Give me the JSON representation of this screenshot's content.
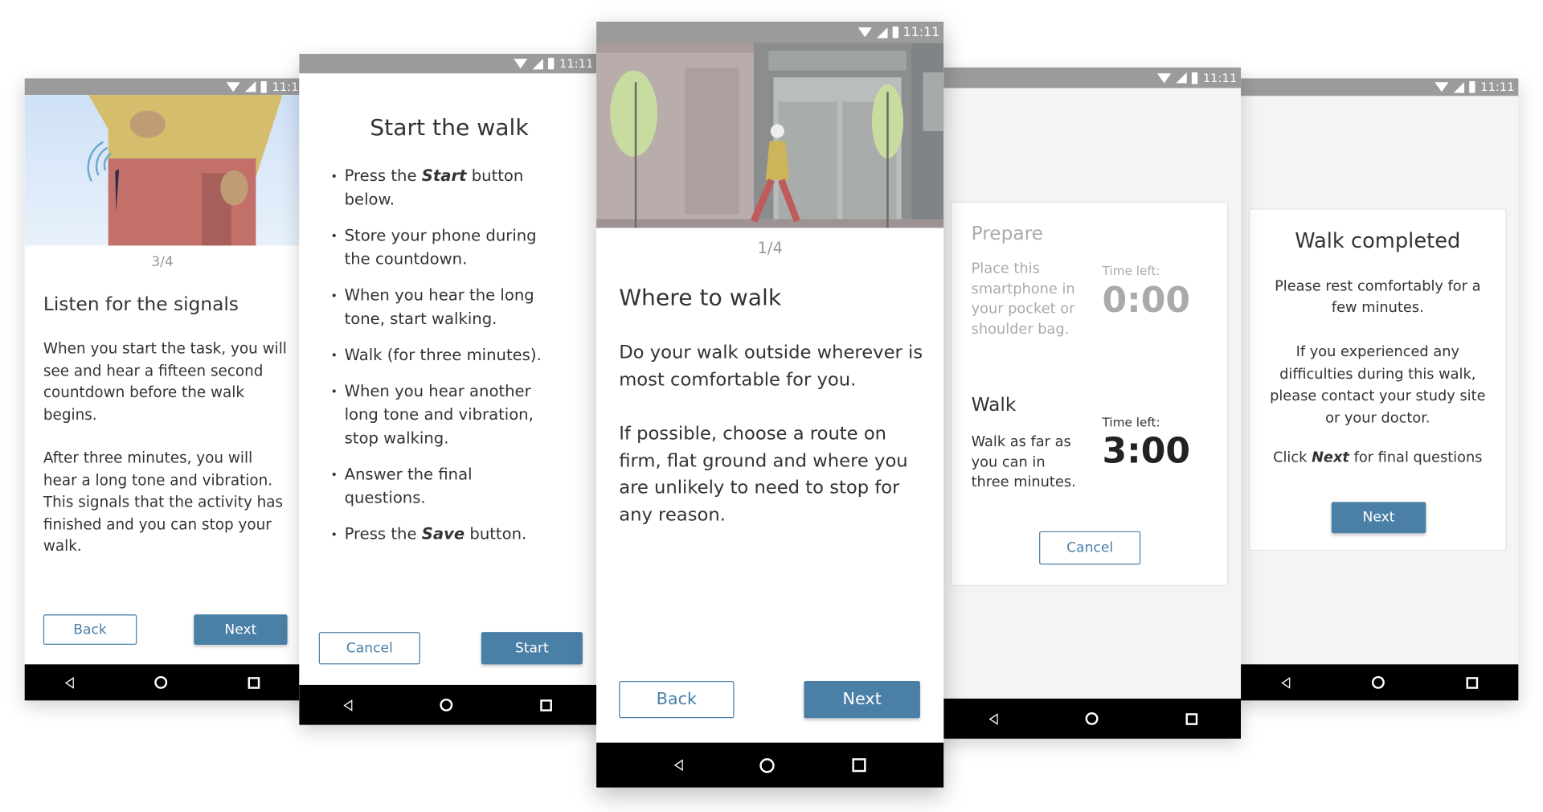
{
  "status_time": "11:11",
  "screens": [
    {
      "step": "3/4",
      "title": "Listen for the signals",
      "paragraphs": [
        "When you start the task, you will see and hear a fifteen second countdown before the walk begins.",
        "After three minutes, you will hear a long tone and vibration. This signals that the activity has finished and you can stop your walk."
      ],
      "back": "Back",
      "next": "Next"
    },
    {
      "title": "Start the walk",
      "bullets": [
        {
          "pre": "Press the ",
          "bold": "Start",
          "post": " button below."
        },
        {
          "pre": "Store your phone during the countdown.",
          "bold": "",
          "post": ""
        },
        {
          "pre": "When you hear the long tone, start walking.",
          "bold": "",
          "post": ""
        },
        {
          "pre": "Walk (for three minutes).",
          "bold": "",
          "post": ""
        },
        {
          "pre": "When you hear another long tone and vibration, stop walking.",
          "bold": "",
          "post": ""
        },
        {
          "pre": "Answer the final questions.",
          "bold": "",
          "post": ""
        },
        {
          "pre": "Press the ",
          "bold": "Save",
          "post": " button."
        }
      ],
      "cancel": "Cancel",
      "start": "Start"
    },
    {
      "step": "1/4",
      "title": "Where to walk",
      "paragraphs": [
        "Do your walk outside wherever is most comfortable for you.",
        "If possible, choose a route on firm, flat ground and where you are unlikely to need to stop for any reason."
      ],
      "back": "Back",
      "next": "Next"
    },
    {
      "prepare_title": "Prepare",
      "prepare_text": "Place this smartphone in your pocket or shoulder bag.",
      "prepare_time_label": "Time left:",
      "prepare_time": "0:00",
      "walk_title": "Walk",
      "walk_text": "Walk as far as you can in three minutes.",
      "walk_time_label": "Time left:",
      "walk_time": "3:00",
      "cancel": "Cancel"
    },
    {
      "title": "Walk completed",
      "p1": "Please rest comfortably for a few minutes.",
      "p2": "If you experienced any difficulties during this walk, please contact your study site or your doctor.",
      "p3_pre": "Click ",
      "p3_bold": "Next",
      "p3_post": " for final questions",
      "next": "Next"
    }
  ],
  "colors": {
    "accent": "#4a7fa6",
    "status_bar": "#9b9b9b"
  }
}
